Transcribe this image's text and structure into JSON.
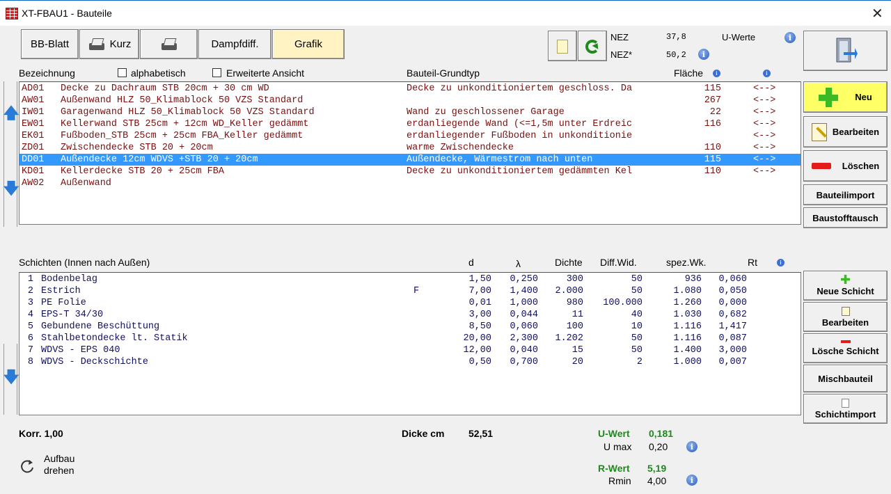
{
  "window": {
    "title": "XT-FBAU1 - Bauteile",
    "close_glyph": "✕"
  },
  "toolbar": {
    "bb_blatt": "BB-Blatt",
    "kurz": "Kurz",
    "dampfdiff": "Dampfdiff.",
    "grafik": "Grafik"
  },
  "nez": {
    "label1": "NEZ",
    "value1": "37,8",
    "label2": "NEZ*",
    "value2": "50,2",
    "u_werte": "U-Werte"
  },
  "components": {
    "headers": {
      "bezeichnung": "Bezeichnung",
      "alphabetisch": "alphabetisch",
      "erweiterte": "Erweiterte Ansicht",
      "grundtyp": "Bauteil-Grundtyp",
      "flaeche": "Fläche"
    },
    "rows": [
      {
        "code": "AD01",
        "name": "Decke zu Dachraum STB 20cm + 30 cm WD",
        "type": "Decke zu unkonditioniertem geschloss. Da",
        "area": "115",
        "link": "<-->",
        "selected": false
      },
      {
        "code": "AW01",
        "name": "Außenwand HLZ 50_Klimablock 50 VZS Standard",
        "type": "",
        "area": "267",
        "link": "<-->",
        "selected": false
      },
      {
        "code": "IW01",
        "name": "Garagenwand HLZ 50_Klimablock 50 VZS Standard",
        "type": "Wand zu geschlossener Garage",
        "area": "22",
        "link": "<-->",
        "selected": false
      },
      {
        "code": "EW01",
        "name": "Kellerwand STB 25cm + 12cm WD_Keller gedämmt",
        "type": "erdanliegende Wand (<=1,5m unter Erdreic",
        "area": "116",
        "link": "<-->",
        "selected": false
      },
      {
        "code": "EK01",
        "name": "Fußboden_STB 25cm + 25cm FBA_Keller gedämmt",
        "type": "erdanliegender Fußboden in unkonditionie",
        "area": "",
        "link": "<-->",
        "selected": false
      },
      {
        "code": "ZD01",
        "name": "Zwischendecke STB 20 + 20cm",
        "type": "warme Zwischendecke",
        "area": "110",
        "link": "<-->",
        "selected": false
      },
      {
        "code": "DD01",
        "name": "Außendecke 12cm WDVS +STB 20 + 20cm",
        "type": "Außendecke, Wärmestrom nach unten",
        "area": "115",
        "link": "<-->",
        "selected": true
      },
      {
        "code": "KD01",
        "name": "Kellerdecke STB 20 + 25cm FBA",
        "type": "Decke zu unkonditioniertem gedämmten Kel",
        "area": "110",
        "link": "<-->",
        "selected": false
      },
      {
        "code": "AW02",
        "name": "Außenwand",
        "type": "",
        "area": "",
        "link": "",
        "selected": false
      }
    ]
  },
  "side_buttons": {
    "neu": "Neu",
    "bearbeiten": "Bearbeiten",
    "loeschen": "Löschen",
    "bauteilimport": "Bauteilimport",
    "baustofftausch": "Baustofftausch"
  },
  "layers": {
    "headers": {
      "title": "Schichten (Innen nach Außen)",
      "d": "d",
      "lambda": "λ",
      "dichte": "Dichte",
      "diff": "Diff.Wid.",
      "spez": "spez.Wk.",
      "rt": "Rt"
    },
    "rows": [
      {
        "nr": "1",
        "name": "Bodenbelag",
        "flag": "",
        "d": "1,50",
        "lambda": "0,250",
        "dichte": "300",
        "diff": "50",
        "spez": "936",
        "rt": "0,060"
      },
      {
        "nr": "2",
        "name": "Estrich",
        "flag": "F",
        "d": "7,00",
        "lambda": "1,400",
        "dichte": "2.000",
        "diff": "50",
        "spez": "1.080",
        "rt": "0,050"
      },
      {
        "nr": "3",
        "name": "PE Folie",
        "flag": "",
        "d": "0,01",
        "lambda": "1,000",
        "dichte": "980",
        "diff": "100.000",
        "spez": "1.260",
        "rt": "0,000"
      },
      {
        "nr": "4",
        "name": "EPS-T 34/30",
        "flag": "",
        "d": "3,00",
        "lambda": "0,044",
        "dichte": "11",
        "diff": "40",
        "spez": "1.030",
        "rt": "0,682"
      },
      {
        "nr": "5",
        "name": "Gebundene Beschüttung",
        "flag": "",
        "d": "8,50",
        "lambda": "0,060",
        "dichte": "100",
        "diff": "10",
        "spez": "1.116",
        "rt": "1,417"
      },
      {
        "nr": "6",
        "name": "Stahlbetondecke lt. Statik",
        "flag": "",
        "d": "20,00",
        "lambda": "2,300",
        "dichte": "1.202",
        "diff": "50",
        "spez": "1.116",
        "rt": "0,087"
      },
      {
        "nr": "7",
        "name": "WDVS - EPS 040",
        "flag": "",
        "d": "12,00",
        "lambda": "0,040",
        "dichte": "15",
        "diff": "50",
        "spez": "1.400",
        "rt": "3,000"
      },
      {
        "nr": "8",
        "name": "WDVS - Deckschichte",
        "flag": "",
        "d": "0,50",
        "lambda": "0,700",
        "dichte": "20",
        "diff": "2",
        "spez": "1.000",
        "rt": "0,007"
      }
    ]
  },
  "layer_buttons": {
    "neue_schicht": "Neue Schicht",
    "bearbeiten": "Bearbeiten",
    "loesche_schicht": "Lösche Schicht",
    "mischbauteil": "Mischbauteil",
    "schichtimport": "Schichtimport"
  },
  "footer": {
    "korr": "Korr. 1,00",
    "dicke_label": "Dicke cm",
    "dicke_value": "52,51",
    "uwert_label": "U-Wert",
    "uwert_value": "0,181",
    "umax_label": "U max",
    "umax_value": "0,20",
    "rwert_label": "R-Wert",
    "rwert_value": "5,19",
    "rmin_label": "Rmin",
    "rmin_value": "4,00",
    "aufbau_line1": "Aufbau",
    "aufbau_line2": "drehen"
  },
  "colors": {
    "selection": "#3399ff",
    "row_text": "#7a0f0f",
    "layer_text": "#101060",
    "accent_green": "#1e8a1e",
    "neu_bg": "#ffff66"
  }
}
